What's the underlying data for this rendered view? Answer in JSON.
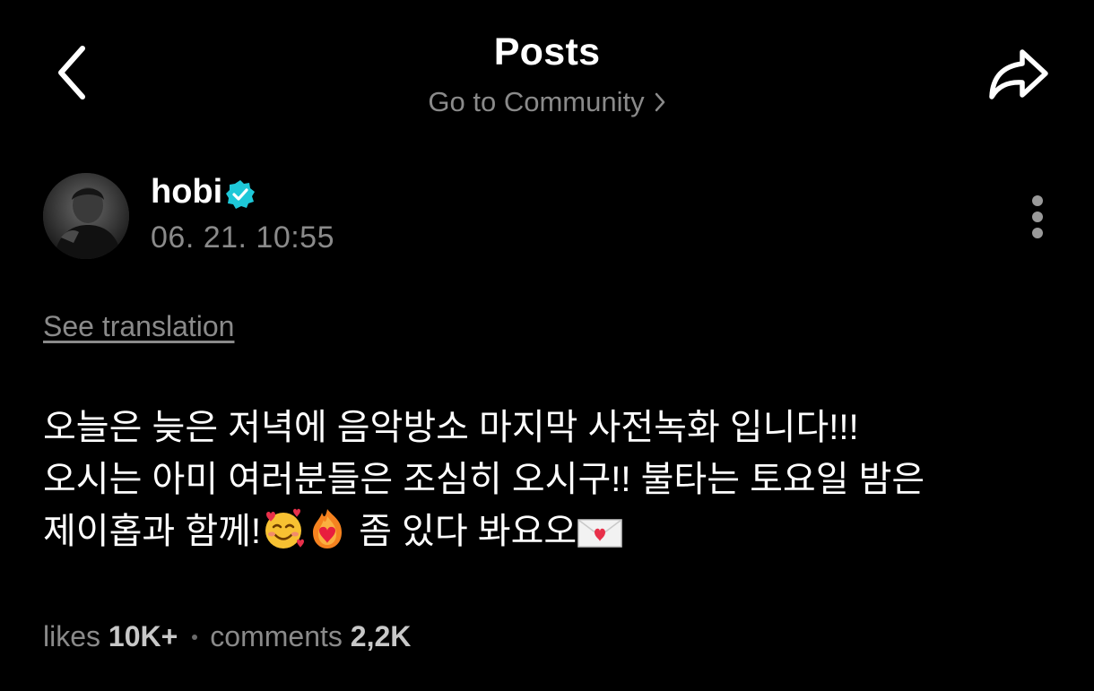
{
  "header": {
    "title": "Posts",
    "community_link_label": "Go to Community",
    "back_icon": "chevron-left-icon",
    "share_icon": "share-arrow-icon"
  },
  "author": {
    "name": "hobi",
    "verified": true,
    "verified_color": "#1ec8d8",
    "date": "06. 21. 10:55"
  },
  "post": {
    "see_translation_label": "See translation",
    "lines": [
      "오늘은 늦은 저녁에 음악방소 마지막 사전녹화 입니다!!!",
      "오시는 아미 여러분들은 조심히 오시구!! 불타는 토요일 밤은",
      "제이홉과 함께!"
    ],
    "line3_tail": " 좀 있다 봐요오",
    "emojis": [
      "smiling-face-with-hearts-icon",
      "heart-on-fire-icon",
      "love-letter-icon"
    ]
  },
  "stats": {
    "likes_label": "likes",
    "likes_count": "10K+",
    "comments_label": "comments",
    "comments_count": "2,2K"
  },
  "colors": {
    "background": "#000000",
    "text_primary": "#ffffff",
    "text_secondary": "#8a8a8a"
  }
}
